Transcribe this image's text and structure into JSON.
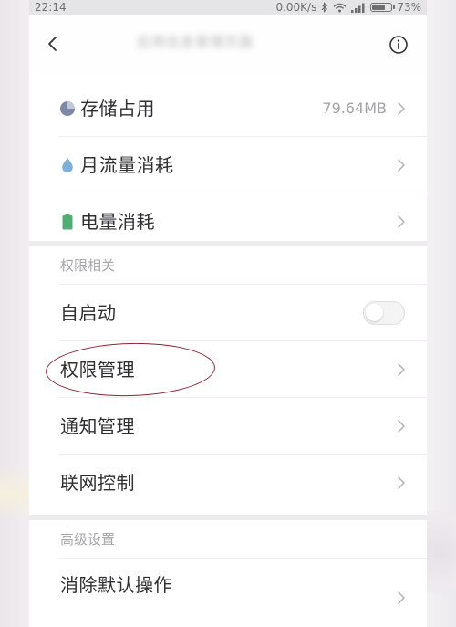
{
  "status_bar": {
    "time": "22:14",
    "network_speed": "0.00K/s",
    "battery_percent": "73%",
    "battery_level": 0.73,
    "icons": [
      "bluetooth-icon",
      "wifi-icon",
      "signal-icon",
      "battery-icon"
    ]
  },
  "title_bar": {
    "title": "应用信息管理页面",
    "back_icon": "chevron-left-icon",
    "info_icon": "info-icon"
  },
  "usage_section": {
    "items": [
      {
        "label": "存储占用",
        "value": "79.64MB",
        "icon": "pie-chart-icon",
        "icon_color": "#7e87a6"
      },
      {
        "label": "月流量消耗",
        "icon": "droplet-icon",
        "icon_color": "#7fb0dc"
      },
      {
        "label": "电量消耗",
        "icon": "battery-icon",
        "icon_color": "#4fae74"
      }
    ]
  },
  "permission_section": {
    "header": "权限相关",
    "items": [
      {
        "label": "自启动",
        "toggle_on": false
      },
      {
        "label": "权限管理",
        "highlighted": true
      },
      {
        "label": "通知管理"
      },
      {
        "label": "联网控制"
      }
    ]
  },
  "advanced_section": {
    "header": "高级设置",
    "items": [
      {
        "label": "消除默认操作"
      }
    ]
  },
  "colors": {
    "text_primary": "#2f2f31",
    "text_secondary": "#a4a4a7",
    "annotation_circle": "#8a2634",
    "card_background": "#ffffff",
    "page_background": "#ececed"
  }
}
